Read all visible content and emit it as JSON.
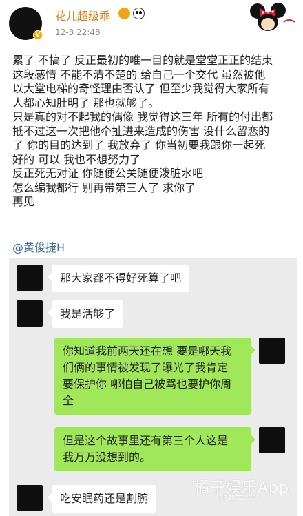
{
  "post": {
    "username": "花儿超级乖",
    "timestamp": "12-3 22:48",
    "emoji_1": "angry-face-emoji",
    "emoji_2": "panda-emoji",
    "decoration": "minnie-mouse-sticker",
    "verified_badge": "v-badge-icon",
    "lines": [
      "累了 不搞了 反正最初的唯一目的就是堂堂正正的结束",
      "这段感情 不能不清不楚的 给自己一个交代 虽然被他",
      "以大堂电梯的奇怪理由否认了 但至少我觉得大家所有",
      "人都心知肚明了 那也就够了。",
      "只是真的对不起我的偶像 我觉得这三年 所有的付出都",
      "抵不过这一次把他牵扯进来造成的伤害 没什么留恋的",
      "了 你的目的达到了 我放弃了 你当初要我跟你一起死",
      "好的 可以 我也不想努力了",
      "反正死无对证 你随便公关随便泼脏水吧",
      "怎么编我都行 别再带第三人了 求你了",
      "再见"
    ],
    "mention": "@黄俊捷H"
  },
  "chat": {
    "messages": [
      {
        "side": "in",
        "text": "那大家都不得好死算了吧"
      },
      {
        "side": "in",
        "text": "我是活够了"
      },
      {
        "side": "out",
        "lines": [
          "你知道我前两天还在想 要是哪天我",
          "们俩的事情被发现了曝光了我肯定",
          "要保护你 哪怕自己被骂也要护你周",
          "全"
        ]
      },
      {
        "side": "out",
        "lines": [
          "但是这个故事里还有第三个人这是",
          "我万万没想到的。"
        ]
      },
      {
        "side": "in",
        "text": "吃安眠药还是割腕"
      }
    ]
  },
  "watermark": {
    "text": "橘子娱乐App",
    "sub": "PPJUZI.COM"
  },
  "colors": {
    "username": "#e8750c",
    "mention": "#3b6ea8",
    "bubble_out": "#a0e75a",
    "chat_bg": "#ebebeb"
  }
}
